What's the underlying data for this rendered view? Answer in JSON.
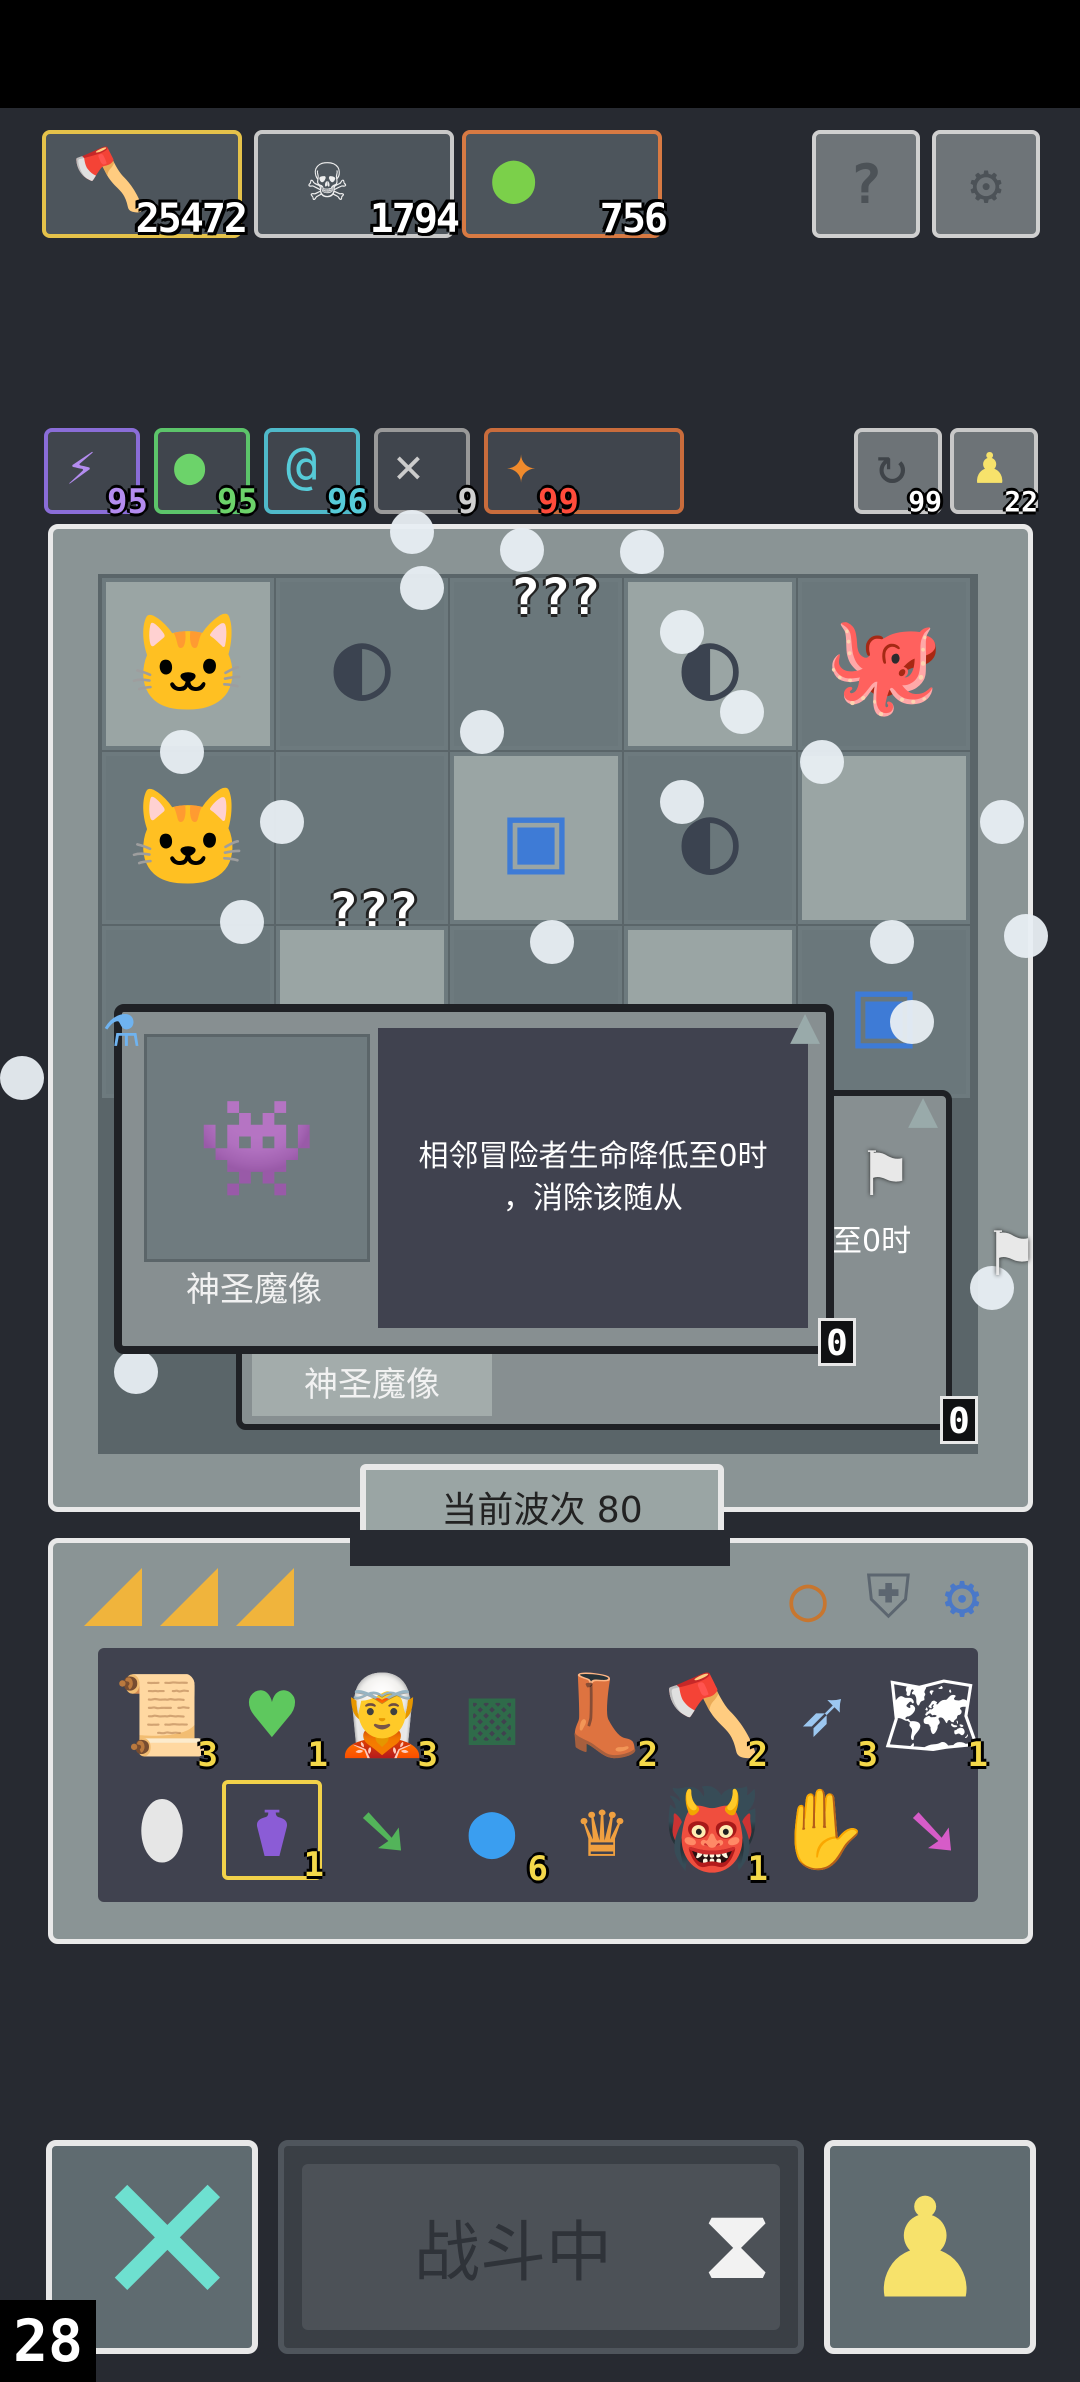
{
  "resources": [
    {
      "icon": "axe-icon",
      "value": "25472",
      "border": "#e5c24a"
    },
    {
      "icon": "skull-icon",
      "value": "1794",
      "border": "#c9c9c9"
    },
    {
      "icon": "slime-icon",
      "value": "756",
      "border": "#d87a43"
    }
  ],
  "top_buttons": {
    "help_label": "?",
    "settings_label": "⚙"
  },
  "stats": [
    {
      "icon": "lightning-icon",
      "value": "95",
      "color": "#a87be8"
    },
    {
      "icon": "slime-icon",
      "value": "95",
      "color": "#6cd36a"
    },
    {
      "icon": "spiral-icon",
      "value": "96",
      "color": "#56cbd8"
    },
    {
      "icon": "bird-icon",
      "value": "9",
      "color": "#c9c9c9"
    },
    {
      "icon": "fire-icon",
      "value": "99",
      "color": "#e2483a"
    }
  ],
  "right_counters": {
    "refresh": "99",
    "pawn": "22"
  },
  "board": {
    "unknown_label": "???",
    "wave_label": "当前波次 80"
  },
  "popup_front": {
    "name": "神圣魔像",
    "description": "相邻冒险者生命降低至0时\n，消除该随从",
    "counter": "0"
  },
  "popup_back": {
    "name": "神圣魔像",
    "partial_text": "至0时",
    "counter": "0"
  },
  "inventory": {
    "items": [
      {
        "icon": "scroll-icon",
        "count": "3"
      },
      {
        "icon": "green-heart-icon",
        "count": "1"
      },
      {
        "icon": "hooded-figure-icon",
        "count": "3"
      },
      {
        "icon": "moss-block-icon",
        "count": ""
      },
      {
        "icon": "boot-icon",
        "count": "2"
      },
      {
        "icon": "red-axe-icon",
        "count": "2"
      },
      {
        "icon": "crossbow-icon",
        "count": "3"
      },
      {
        "icon": "map-icon",
        "count": "1"
      },
      {
        "icon": "egg-icon",
        "count": ""
      },
      {
        "icon": "potion-icon",
        "count": "1"
      },
      {
        "icon": "green-arrow-icon",
        "count": ""
      },
      {
        "icon": "blue-orb-icon",
        "count": "6"
      },
      {
        "icon": "crown-icon",
        "count": ""
      },
      {
        "icon": "demon-mask-icon",
        "count": "1"
      },
      {
        "icon": "eye-hand-icon",
        "count": ""
      },
      {
        "icon": "pink-arrow-icon",
        "count": ""
      }
    ]
  },
  "bottom": {
    "battle_label": "战斗中",
    "fps": "28"
  },
  "colors": {
    "background": "#272a31",
    "board": "#8a9495",
    "accent_cyan": "#6ee0d0",
    "accent_yellow": "#f7e26b"
  }
}
